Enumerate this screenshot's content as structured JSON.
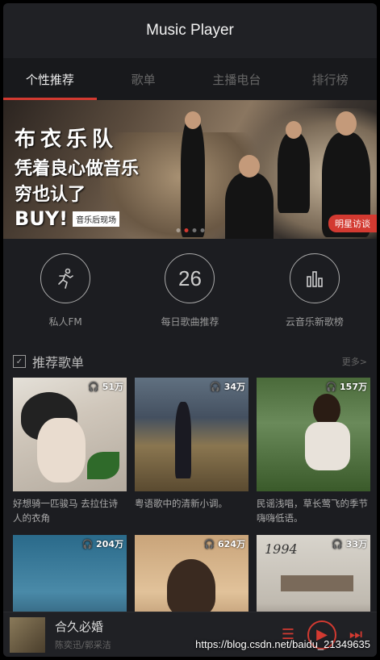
{
  "app": {
    "title": "Music Player"
  },
  "tabs": [
    {
      "label": "个性推荐"
    },
    {
      "label": "歌单"
    },
    {
      "label": "主播电台"
    },
    {
      "label": "排行榜"
    }
  ],
  "banner": {
    "line1": "布衣乐队",
    "line2": "凭着良心做音乐",
    "line3": "穷也认了",
    "line4": "BUY!",
    "tag": "音乐后现场",
    "badge": "明星访谈"
  },
  "quick": [
    {
      "label": "私人FM",
      "icon": "running-person-icon"
    },
    {
      "label": "每日歌曲推荐",
      "number": "26"
    },
    {
      "label": "云音乐新歌榜",
      "icon": "bar-chart-icon"
    }
  ],
  "section": {
    "title": "推荐歌单",
    "more": "更多>"
  },
  "playlists": [
    {
      "count": "51万",
      "caption": "好想骑一匹骏马 去拉住诗人的衣角"
    },
    {
      "count": "34万",
      "caption": "粤语歌中的清新小调。"
    },
    {
      "count": "157万",
      "caption": "民谣浅唱，草长莺飞的季节嗨嗨低语。"
    },
    {
      "count": "204万",
      "caption": ""
    },
    {
      "count": "624万",
      "caption": ""
    },
    {
      "count": "33万",
      "caption": ""
    }
  ],
  "player": {
    "title": "合久必婚",
    "artist": "陈奕迅/郭采洁"
  },
  "watermark": "https://blog.csdn.net/baidu_21349635",
  "colors": {
    "accent": "#d33a31",
    "background": "#1c1d21"
  }
}
